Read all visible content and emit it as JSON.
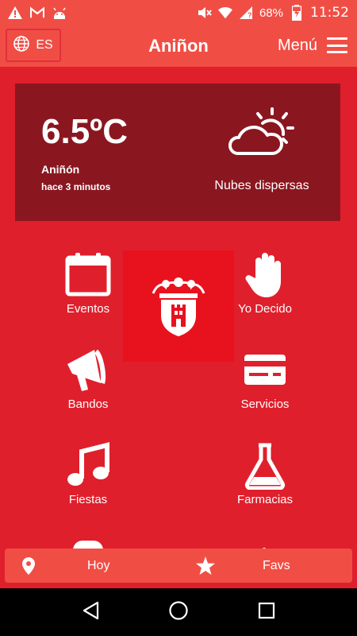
{
  "status_bar": {
    "battery": "68%",
    "time": "11:52",
    "icons": [
      "warning-icon",
      "gmail-icon",
      "android-icon",
      "mute-icon",
      "wifi-icon",
      "signal-icon",
      "battery-charging-icon"
    ]
  },
  "header": {
    "lang_code": "ES",
    "title": "Aniñon",
    "menu_label": "Menú"
  },
  "weather": {
    "temperature": "6.5ºC",
    "town": "Aniñón",
    "updated": "hace 3 minutos",
    "description": "Nubes dispersas",
    "icon": "partly-cloudy-icon"
  },
  "grid": {
    "eventos": "Eventos",
    "yo_decido": "Yo Decido",
    "bandos": "Bandos",
    "servicios": "Servicios",
    "fiestas": "Fiestas",
    "farmacias": "Farmacias"
  },
  "bottom_bar": {
    "hoy": "Hoy",
    "favs": "Favs"
  },
  "colors": {
    "background": "#e01f2c",
    "header": "#f04e45",
    "weather_card": "#8a1720",
    "logo_tile": "#e8121e"
  }
}
